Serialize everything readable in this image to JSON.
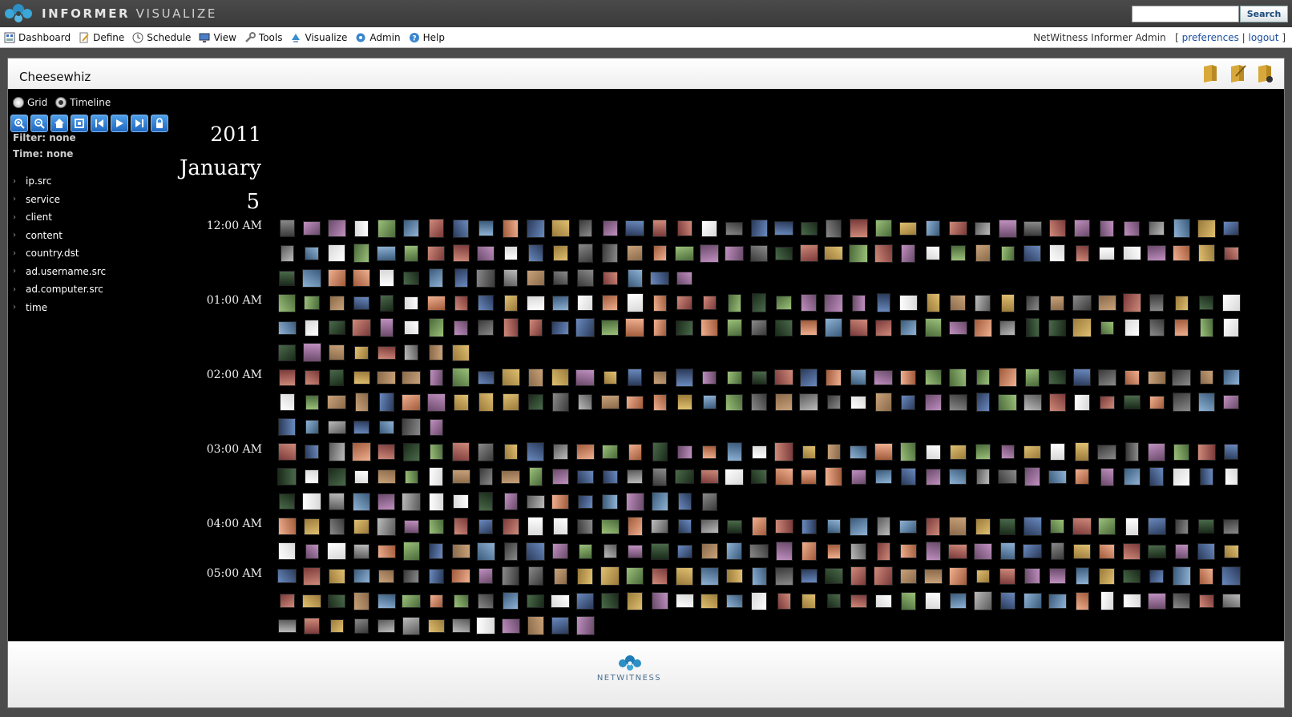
{
  "app": {
    "brand_bold": "INFORMER",
    "brand_thin": "VISUALIZE"
  },
  "search": {
    "placeholder": "",
    "button_label": "Search"
  },
  "menu": [
    {
      "label": "Dashboard",
      "icon": "dashboard-icon"
    },
    {
      "label": "Define",
      "icon": "define-icon"
    },
    {
      "label": "Schedule",
      "icon": "clock-icon"
    },
    {
      "label": "View",
      "icon": "monitor-icon"
    },
    {
      "label": "Tools",
      "icon": "wrench-icon"
    },
    {
      "label": "Visualize",
      "icon": "visualize-icon"
    },
    {
      "label": "Admin",
      "icon": "gear-icon"
    },
    {
      "label": "Help",
      "icon": "help-icon"
    }
  ],
  "user": {
    "name": "NetWitness Informer Admin",
    "open_bracket": "[",
    "preferences": "preferences",
    "separator": "|",
    "logout": "logout",
    "close_bracket": "]"
  },
  "panel": {
    "title": "Cheesewhiz"
  },
  "view_mode": {
    "grid_label": "Grid",
    "timeline_label": "Timeline",
    "selected": "Timeline"
  },
  "toolbar_buttons": [
    "zoom-in",
    "zoom-out",
    "home",
    "fit",
    "first",
    "play",
    "last",
    "lock"
  ],
  "filter": {
    "filter_text": "Filter: none",
    "time_text": "Time: none"
  },
  "tree": [
    "ip.src",
    "service",
    "client",
    "content",
    "country.dst",
    "ad.username.src",
    "ad.computer.src",
    "time"
  ],
  "timeline": {
    "year": "2011",
    "month": "January",
    "day": "5",
    "hours": [
      "12:00 AM",
      "01:00 AM",
      "02:00 AM",
      "03:00 AM",
      "04:00 AM",
      "05:00 AM"
    ],
    "row_counts": [
      39,
      39,
      17,
      39,
      39,
      8,
      39,
      39,
      7,
      39,
      39,
      18,
      39,
      39,
      39,
      39,
      13
    ]
  },
  "footer": {
    "text": "NETWITNESS"
  },
  "colors": {
    "topbar": "#3f3f3f",
    "panel_bg": "#000000",
    "toolbar_blue": "#2a7ad6",
    "link": "#1a4ea0"
  }
}
